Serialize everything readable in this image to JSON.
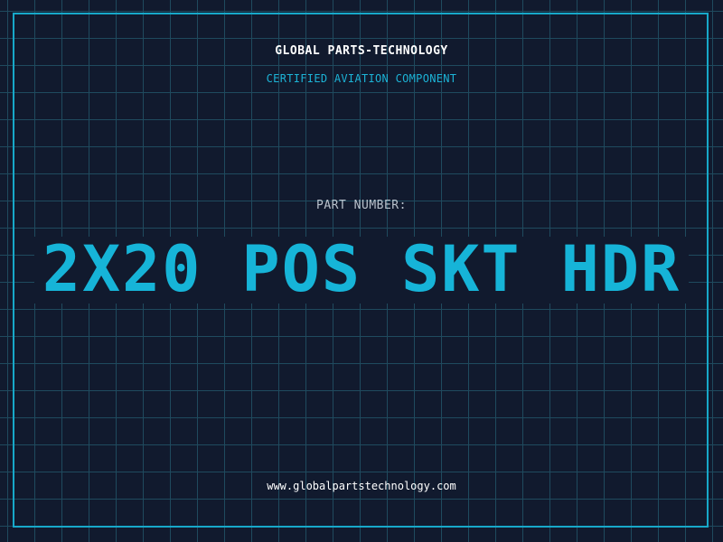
{
  "header": {
    "company": "GLOBAL PARTS-TECHNOLOGY",
    "tagline": "CERTIFIED AVIATION COMPONENT"
  },
  "part": {
    "label": "PART NUMBER:",
    "number": "2X20 POS SKT HDR"
  },
  "footer": {
    "website": "www.globalpartstechnology.com"
  },
  "colors": {
    "background": "#111a2e",
    "grid": "#1f4a5e",
    "accent": "#16b4d8",
    "frame": "#17a8c9",
    "text": "#ffffff",
    "muted": "#b9c2cc"
  }
}
